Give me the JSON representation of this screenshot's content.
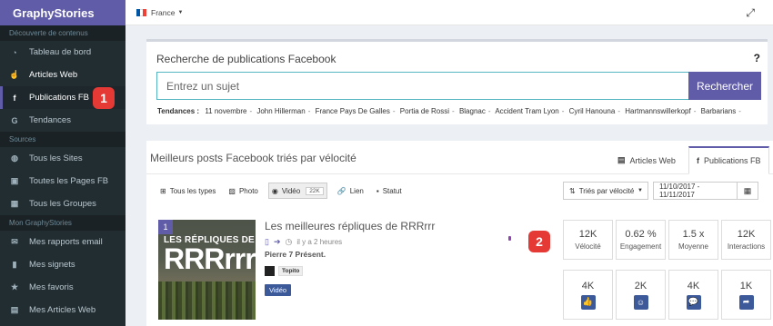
{
  "brand": "GraphyStories",
  "sidebar": {
    "sections": [
      {
        "title": "Découverte de contenus",
        "items": [
          {
            "label": "Tableau de bord",
            "icon": "dashboard-icon"
          },
          {
            "label": "Articles Web",
            "icon": "hand-pointer-icon"
          },
          {
            "label": "Publications FB",
            "icon": "facebook-icon"
          },
          {
            "label": "Tendances",
            "icon": "google-icon"
          }
        ]
      },
      {
        "title": "Sources",
        "items": [
          {
            "label": "Tous les Sites",
            "icon": "globe-icon"
          },
          {
            "label": "Toutes les Pages FB",
            "icon": "facebook-square-icon"
          },
          {
            "label": "Tous les Groupes",
            "icon": "grid-icon"
          }
        ]
      },
      {
        "title": "Mon GraphyStories",
        "items": [
          {
            "label": "Mes rapports email",
            "icon": "envelope-icon"
          },
          {
            "label": "Mes signets",
            "icon": "bookmark-icon"
          },
          {
            "label": "Mes favoris",
            "icon": "star-icon"
          },
          {
            "label": "Mes Articles Web",
            "icon": "document-icon"
          }
        ]
      }
    ],
    "badge": "1"
  },
  "topbar": {
    "country": "France",
    "flag_colors": [
      "#0055a4",
      "#ffffff",
      "#ef4135"
    ]
  },
  "search": {
    "title": "Recherche de publications Facebook",
    "placeholder": "Entrez un sujet",
    "button": "Rechercher",
    "help": "?",
    "trends_label": "Tendances :",
    "trends": [
      "11 novembre",
      "John Hillerman",
      "France Pays De Galles",
      "Portia de Rossi",
      "Blagnac",
      "Accident Tram Lyon",
      "Cyril Hanouna",
      "Hartmannswillerkopf",
      "Barbarians"
    ]
  },
  "posts": {
    "title": "Meilleurs posts Facebook triés par vélocité",
    "tabs": [
      {
        "label": "Articles Web"
      },
      {
        "label": "Publications FB"
      }
    ],
    "filters": {
      "all_types": "Tous les types",
      "photo": "Photo",
      "video": "Vidéo",
      "video_count": "22K",
      "link": "Lien",
      "status": "Statut"
    },
    "sort": "Triés par vélocité",
    "date_range": "11/10/2017 - 11/11/2017",
    "item": {
      "rank": "1",
      "title": "Les meilleures répliques de RRRrrr",
      "time": "il y a 2 heures",
      "author": "Pierre 7 Présent.",
      "source": "Topito",
      "type": "Vidéo",
      "thumb_line1": "LES RÉPLIQUES DE",
      "thumb_line2": "RRRrrr,",
      "badge": "2",
      "stats": [
        {
          "value": "12K",
          "label": "Vélocité"
        },
        {
          "value": "0.62 %",
          "label": "Engagement"
        },
        {
          "value": "1.5 x",
          "label": "Moyenne"
        },
        {
          "value": "12K",
          "label": "Interactions"
        }
      ],
      "reactions": [
        {
          "value": "4K",
          "icon": "thumbs-up-icon"
        },
        {
          "value": "2K",
          "icon": "smiley-icon"
        },
        {
          "value": "4K",
          "icon": "comment-icon"
        },
        {
          "value": "1K",
          "icon": "share-icon"
        }
      ]
    }
  }
}
